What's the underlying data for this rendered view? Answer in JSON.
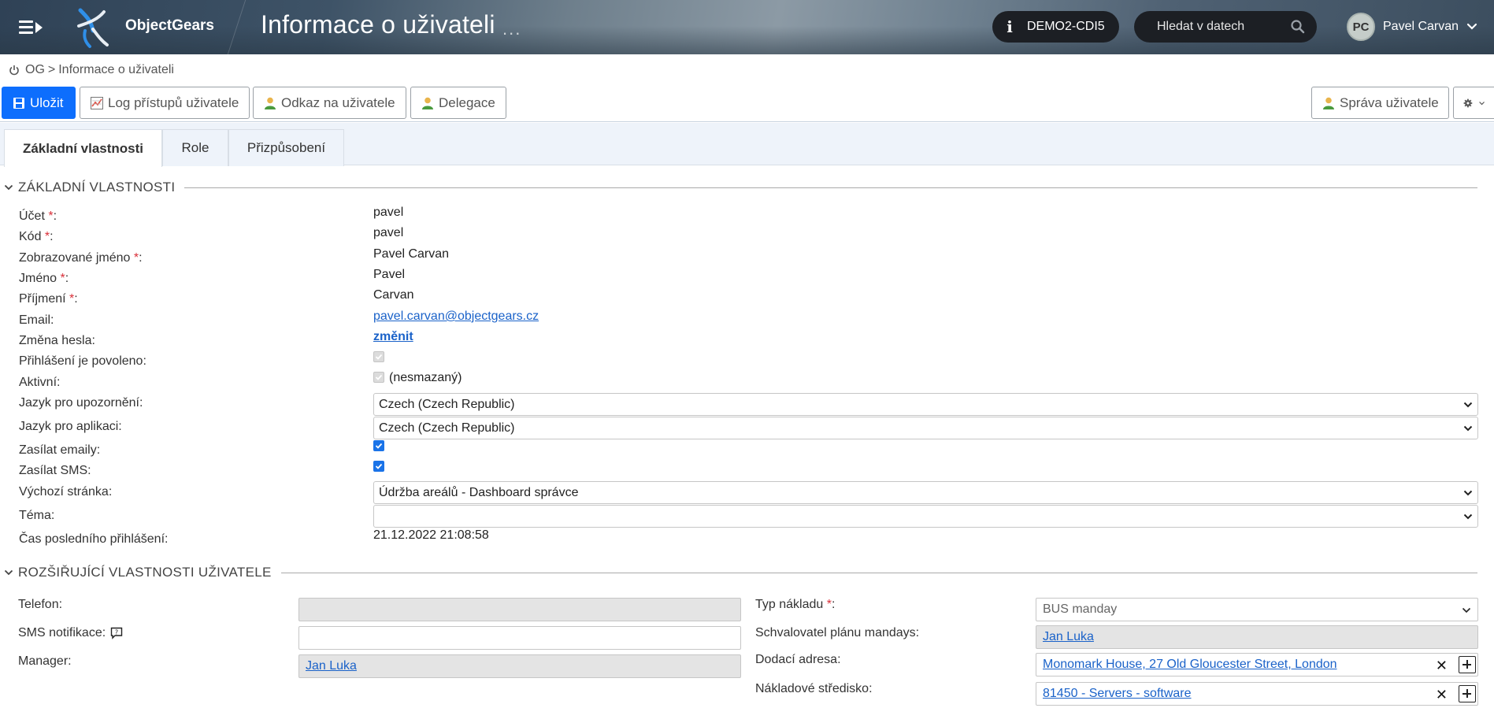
{
  "header": {
    "brand": "ObjectGears",
    "title": "Informace o uživateli",
    "title_dots": "...",
    "environment": "DEMO2-CDI5",
    "search_placeholder": "Hledat v datech",
    "user_initials": "PC",
    "user_name": "Pavel Carvan"
  },
  "breadcrumb": {
    "root": "OG",
    "separator": ">",
    "current": "Informace o uživateli"
  },
  "toolbar": {
    "save": "Uložit",
    "access_log": "Log přístupů uživatele",
    "user_link": "Odkaz na uživatele",
    "delegation": "Delegace",
    "user_admin": "Správa uživatele"
  },
  "tabs": [
    "Základní vlastnosti",
    "Role",
    "Přizpůsobení"
  ],
  "basic": {
    "section_title": "ZÁKLADNÍ VLASTNOSTI",
    "fields": {
      "account": {
        "label": "Účet",
        "value": "pavel"
      },
      "code": {
        "label": "Kód",
        "value": "pavel"
      },
      "display_name": {
        "label": "Zobrazované jméno",
        "value": "Pavel Carvan"
      },
      "first_name": {
        "label": "Jméno",
        "value": "Pavel"
      },
      "last_name": {
        "label": "Příjmení",
        "value": "Carvan"
      },
      "email": {
        "label": "Email:",
        "value": "pavel.carvan@objectgears.cz"
      },
      "password": {
        "label": "Změna hesla:",
        "value": "změnit"
      },
      "login_allowed": {
        "label": "Přihlášení je povoleno:",
        "checked": true
      },
      "active": {
        "label": "Aktivní:",
        "checked": true,
        "note": "(nesmazaný)"
      },
      "notify_lang": {
        "label": "Jazyk pro upozornění:",
        "value": "Czech (Czech Republic)"
      },
      "app_lang": {
        "label": "Jazyk pro aplikaci:",
        "value": "Czech (Czech Republic)"
      },
      "send_emails": {
        "label": "Zasílat emaily:",
        "checked": true
      },
      "send_sms": {
        "label": "Zasílat SMS:",
        "checked": true
      },
      "default_page": {
        "label": "Výchozí stránka:",
        "value": "Údržba areálů - Dashboard správce"
      },
      "theme": {
        "label": "Téma:",
        "value": ""
      },
      "last_login": {
        "label": "Čas posledního přihlášení:",
        "value": "21.12.2022 21:08:58"
      }
    },
    "required_mark": "*",
    "colon": ":"
  },
  "extended": {
    "section_title": "ROZŠIŘUJÍCÍ VLASTNOSTI UŽIVATELE",
    "phone": {
      "label": "Telefon:",
      "value": ""
    },
    "sms_notify": {
      "label": "SMS notifikace:",
      "value": ""
    },
    "manager": {
      "label": "Manager:",
      "value": "Jan Luka"
    },
    "cost_type": {
      "label": "Typ nákladu",
      "value": "BUS manday"
    },
    "approver": {
      "label": "Schvalovatel plánu mandays:",
      "value": "Jan Luka"
    },
    "delivery_address": {
      "label": "Dodací adresa:",
      "value": "Monomark House, 27 Old Gloucester Street, London"
    },
    "cost_center": {
      "label": "Nákladové středisko:",
      "value": "81450 - Servers - software"
    },
    "clear_glyph": "✕"
  },
  "colors": {
    "primary": "#0d6efd",
    "link": "#1a62c9",
    "required": "#d9303a",
    "header_pill": "#1c1f24"
  }
}
